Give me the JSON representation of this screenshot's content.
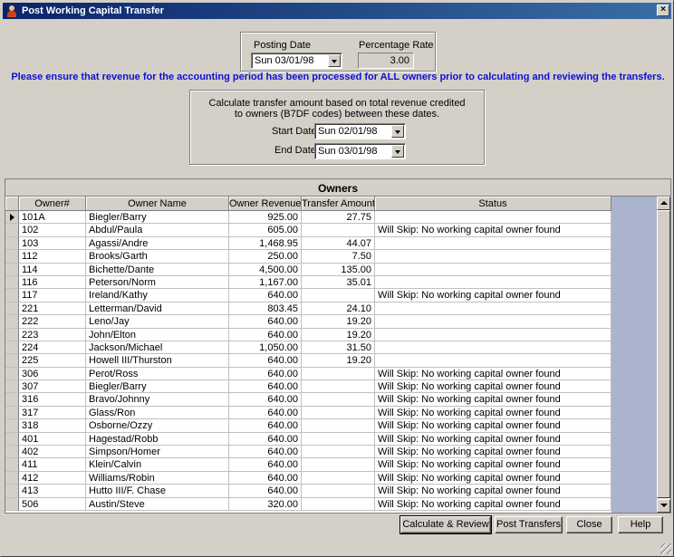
{
  "window": {
    "title": "Post Working Capital Transfer",
    "close_glyph": "×"
  },
  "posting": {
    "date_label": "Posting Date",
    "date_value": "Sun 03/01/98",
    "rate_label": "Percentage Rate",
    "rate_value": "3.00"
  },
  "notice": "Please ensure that revenue for the accounting period has been processed for ALL owners prior to calculating and reviewing the transfers.",
  "range": {
    "description_line1": "Calculate transfer amount based on total revenue credited",
    "description_line2": "to owners (B7DF codes) between these dates.",
    "start_label": "Start Date",
    "start_value": "Sun 02/01/98",
    "end_label": "End Date",
    "end_value": "Sun 03/01/98"
  },
  "grid": {
    "caption": "Owners",
    "columns": [
      "Owner#",
      "Owner Name",
      "Owner Revenue",
      "Transfer Amount",
      "Status"
    ],
    "rows": [
      {
        "owner": "101A",
        "name": "Biegler/Barry",
        "revenue": "925.00",
        "transfer": "27.75",
        "status": ""
      },
      {
        "owner": "102",
        "name": "Abdul/Paula",
        "revenue": "605.00",
        "transfer": "",
        "status": "Will Skip: No working capital owner found"
      },
      {
        "owner": "103",
        "name": "Agassi/Andre",
        "revenue": "1,468.95",
        "transfer": "44.07",
        "status": ""
      },
      {
        "owner": "112",
        "name": "Brooks/Garth",
        "revenue": "250.00",
        "transfer": "7.50",
        "status": ""
      },
      {
        "owner": "114",
        "name": "Bichette/Dante",
        "revenue": "4,500.00",
        "transfer": "135.00",
        "status": ""
      },
      {
        "owner": "116",
        "name": "Peterson/Norm",
        "revenue": "1,167.00",
        "transfer": "35.01",
        "status": ""
      },
      {
        "owner": "117",
        "name": "Ireland/Kathy",
        "revenue": "640.00",
        "transfer": "",
        "status": "Will Skip: No working capital owner found"
      },
      {
        "owner": "221",
        "name": "Letterman/David",
        "revenue": "803.45",
        "transfer": "24.10",
        "status": ""
      },
      {
        "owner": "222",
        "name": "Leno/Jay",
        "revenue": "640.00",
        "transfer": "19.20",
        "status": ""
      },
      {
        "owner": "223",
        "name": "John/Elton",
        "revenue": "640.00",
        "transfer": "19.20",
        "status": ""
      },
      {
        "owner": "224",
        "name": "Jackson/Michael",
        "revenue": "1,050.00",
        "transfer": "31.50",
        "status": ""
      },
      {
        "owner": "225",
        "name": "Howell III/Thurston",
        "revenue": "640.00",
        "transfer": "19.20",
        "status": ""
      },
      {
        "owner": "306",
        "name": "Perot/Ross",
        "revenue": "640.00",
        "transfer": "",
        "status": "Will Skip: No working capital owner found"
      },
      {
        "owner": "307",
        "name": "Biegler/Barry",
        "revenue": "640.00",
        "transfer": "",
        "status": "Will Skip: No working capital owner found"
      },
      {
        "owner": "316",
        "name": "Bravo/Johnny",
        "revenue": "640.00",
        "transfer": "",
        "status": "Will Skip: No working capital owner found"
      },
      {
        "owner": "317",
        "name": "Glass/Ron",
        "revenue": "640.00",
        "transfer": "",
        "status": "Will Skip: No working capital owner found"
      },
      {
        "owner": "318",
        "name": "Osborne/Ozzy",
        "revenue": "640.00",
        "transfer": "",
        "status": "Will Skip: No working capital owner found"
      },
      {
        "owner": "401",
        "name": "Hagestad/Robb",
        "revenue": "640.00",
        "transfer": "",
        "status": "Will Skip: No working capital owner found"
      },
      {
        "owner": "402",
        "name": "Simpson/Homer",
        "revenue": "640.00",
        "transfer": "",
        "status": "Will Skip: No working capital owner found"
      },
      {
        "owner": "411",
        "name": "Klein/Calvin",
        "revenue": "640.00",
        "transfer": "",
        "status": "Will Skip: No working capital owner found"
      },
      {
        "owner": "412",
        "name": "Williams/Robin",
        "revenue": "640.00",
        "transfer": "",
        "status": "Will Skip: No working capital owner found"
      },
      {
        "owner": "413",
        "name": "Hutto III/F. Chase",
        "revenue": "640.00",
        "transfer": "",
        "status": "Will Skip: No working capital owner found"
      },
      {
        "owner": "506",
        "name": "Austin/Steve",
        "revenue": "320.00",
        "transfer": "",
        "status": "Will Skip: No working capital owner found"
      }
    ]
  },
  "buttons": {
    "calculate": "Calculate & Review",
    "post": "Post Transfers",
    "close": "Close",
    "help": "Help"
  },
  "colors": {
    "title_bar": "#0a246a",
    "notice_text": "#1010d0",
    "grid_fill": "#aab4cc",
    "face": "#d4d0c8"
  }
}
